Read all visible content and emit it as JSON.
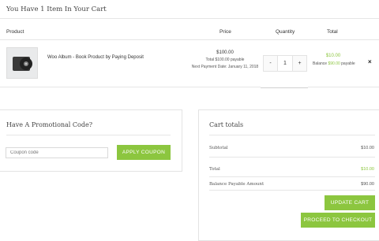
{
  "cart": {
    "title": "You Have 1 Item In Your Cart",
    "headers": {
      "product": "Product",
      "price": "Price",
      "quantity": "Quantity",
      "total": "Total"
    },
    "item": {
      "name": "Woo Album - Book Product by Paying Deposit",
      "price": "$100.00",
      "total_payable_label": "Total $100.00 payable",
      "next_payment_label": "Next Payment Date: January 11, 2018",
      "qty_minus": "-",
      "qty_value": "1",
      "qty_plus": "+",
      "line_total": "$10.00",
      "balance_prefix": "Balance",
      "balance_amount": "$90.00",
      "balance_suffix": "payable",
      "remove": "×"
    }
  },
  "coupon": {
    "title": "Have A Promotional Code?",
    "placeholder": "Coupon code",
    "apply_label": "APPLY COUPON"
  },
  "totals": {
    "title": "Cart totals",
    "subtotal_label": "Subtotal",
    "subtotal_value": "$10.00",
    "total_label": "Total",
    "total_value": "$10.00",
    "balance_label": "Balance Payable Amount",
    "balance_value": "$90.00",
    "update_label": "UPDATE CART",
    "checkout_label": "PROCEED TO CHECKOUT"
  },
  "colors": {
    "accent": "#8cc63f"
  },
  "icons": {
    "remove": "close-icon",
    "product_thumb": "album-thumbnail"
  }
}
